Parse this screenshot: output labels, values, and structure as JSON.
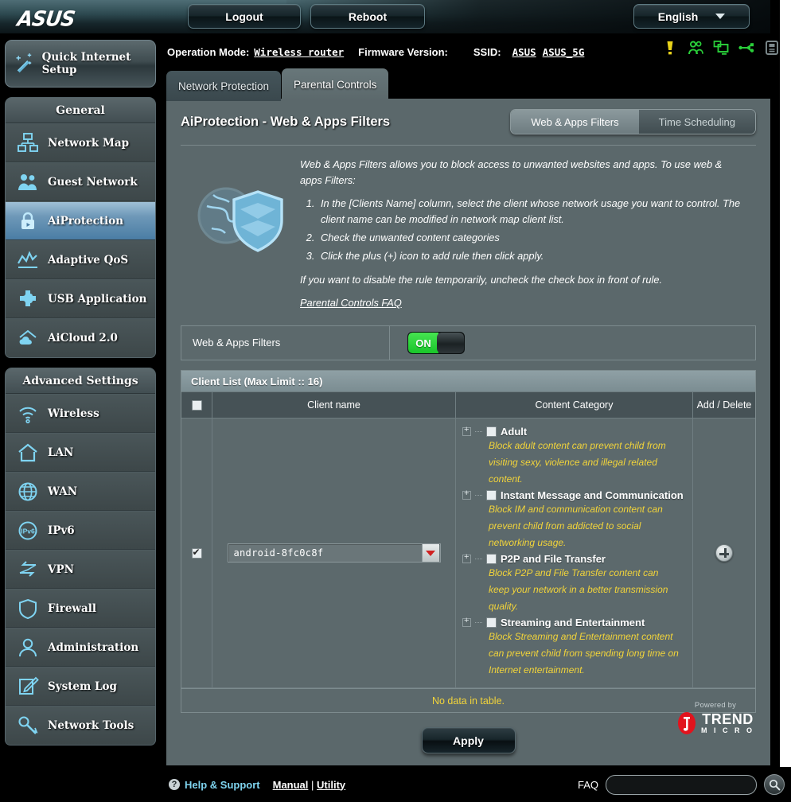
{
  "header": {
    "logo": "ASUS",
    "logout_label": "Logout",
    "reboot_label": "Reboot",
    "language": "English"
  },
  "infobar": {
    "operation_mode_label": "Operation Mode:",
    "operation_mode_value": "Wireless router",
    "firmware_label": "Firmware Version:",
    "firmware_value": "",
    "ssid_label": "SSID:",
    "ssid_1": "ASUS",
    "ssid_2": "ASUS_5G",
    "status_icons": [
      {
        "name": "warning-icon",
        "color": "#e8d21a"
      },
      {
        "name": "clients-users-icon",
        "color": "#2ad03a"
      },
      {
        "name": "monitors-icon",
        "color": "#2ad03a"
      },
      {
        "name": "usb-icon",
        "color": "#2ad03a"
      },
      {
        "name": "printer-icon",
        "color": "#7d8a8d"
      }
    ]
  },
  "sidebar": {
    "quick_setup": "Quick Internet Setup",
    "groups": [
      {
        "title": "General",
        "items": [
          {
            "label": "Network Map",
            "icon": "network-map-icon",
            "active": false
          },
          {
            "label": "Guest Network",
            "icon": "guest-network-icon",
            "active": false
          },
          {
            "label": "AiProtection",
            "icon": "lock-shield-icon",
            "active": true
          },
          {
            "label": "Adaptive QoS",
            "icon": "qos-chart-icon",
            "active": false
          },
          {
            "label": "USB Application",
            "icon": "usb-puzzle-icon",
            "active": false
          },
          {
            "label": "AiCloud 2.0",
            "icon": "aicloud-icon",
            "active": false
          }
        ]
      },
      {
        "title": "Advanced Settings",
        "items": [
          {
            "label": "Wireless",
            "icon": "wifi-icon",
            "active": false
          },
          {
            "label": "LAN",
            "icon": "home-icon",
            "active": false
          },
          {
            "label": "WAN",
            "icon": "globe-icon",
            "active": false
          },
          {
            "label": "IPv6",
            "icon": "ipv6-globe-icon",
            "active": false
          },
          {
            "label": "VPN",
            "icon": "vpn-arrows-icon",
            "active": false
          },
          {
            "label": "Firewall",
            "icon": "firewall-shield-icon",
            "active": false
          },
          {
            "label": "Administration",
            "icon": "administration-user-icon",
            "active": false
          },
          {
            "label": "System Log",
            "icon": "system-log-pencil-icon",
            "active": false
          },
          {
            "label": "Network Tools",
            "icon": "network-tools-wrench-icon",
            "active": false
          }
        ]
      }
    ]
  },
  "tabs": [
    {
      "label": "Network Protection",
      "active": false
    },
    {
      "label": "Parental Controls",
      "active": true
    }
  ],
  "main": {
    "page_title": "AiProtection - Web & Apps Filters",
    "segments": [
      {
        "label": "Web & Apps Filters",
        "active": true
      },
      {
        "label": "Time Scheduling",
        "active": false
      }
    ],
    "intro_paragraph": "Web & Apps Filters allows you to block access to unwanted websites and apps. To use web & apps Filters:",
    "intro_steps": [
      "In the [Clients Name] column, select the client whose network usage you want to control. The client name can be modified in network map client list.",
      "Check the unwanted content categories",
      "Click the plus (+) icon to add rule then click apply."
    ],
    "intro_note": "If you want to disable the rule temporarily, uncheck the check box in front of rule.",
    "faq_link": "Parental Controls FAQ",
    "filter_row_label": "Web & Apps Filters",
    "toggle_state": "ON",
    "toggle_on_color": "#22cc33"
  },
  "table": {
    "caption": "Client List (Max Limit ::  16)",
    "columns": [
      "",
      "Client name",
      "Content Category",
      "Add / Delete"
    ],
    "header_checkbox_checked": false,
    "row": {
      "checked": true,
      "client_name": "android-8fc0c8f",
      "categories": [
        {
          "name": "Adult",
          "checked": false,
          "description": "Block adult content can prevent child from visiting sexy, violence and illegal related content."
        },
        {
          "name": "Instant Message and Communication",
          "checked": false,
          "description": "Block IM and communication content can prevent child from addicted to social networking usage."
        },
        {
          "name": "P2P and File Transfer",
          "checked": false,
          "description": "Block P2P and File Transfer content can keep your network in a better transmission quality."
        },
        {
          "name": "Streaming and Entertainment",
          "checked": false,
          "description": "Block Streaming and Entertainment content can prevent child from spending long time on Internet entertainment."
        }
      ]
    },
    "no_data_text": "No data in table.",
    "no_data_color": "#f2d43a"
  },
  "actions": {
    "apply_label": "Apply"
  },
  "branding": {
    "powered_by": "Powered by",
    "trend": "TREND",
    "micro": "M I C R O"
  },
  "footer": {
    "help_label": "Help & Support",
    "manual": "Manual",
    "separator": "|",
    "utility": "Utility",
    "faq_label": "FAQ",
    "search_value": "",
    "search_placeholder": ""
  }
}
